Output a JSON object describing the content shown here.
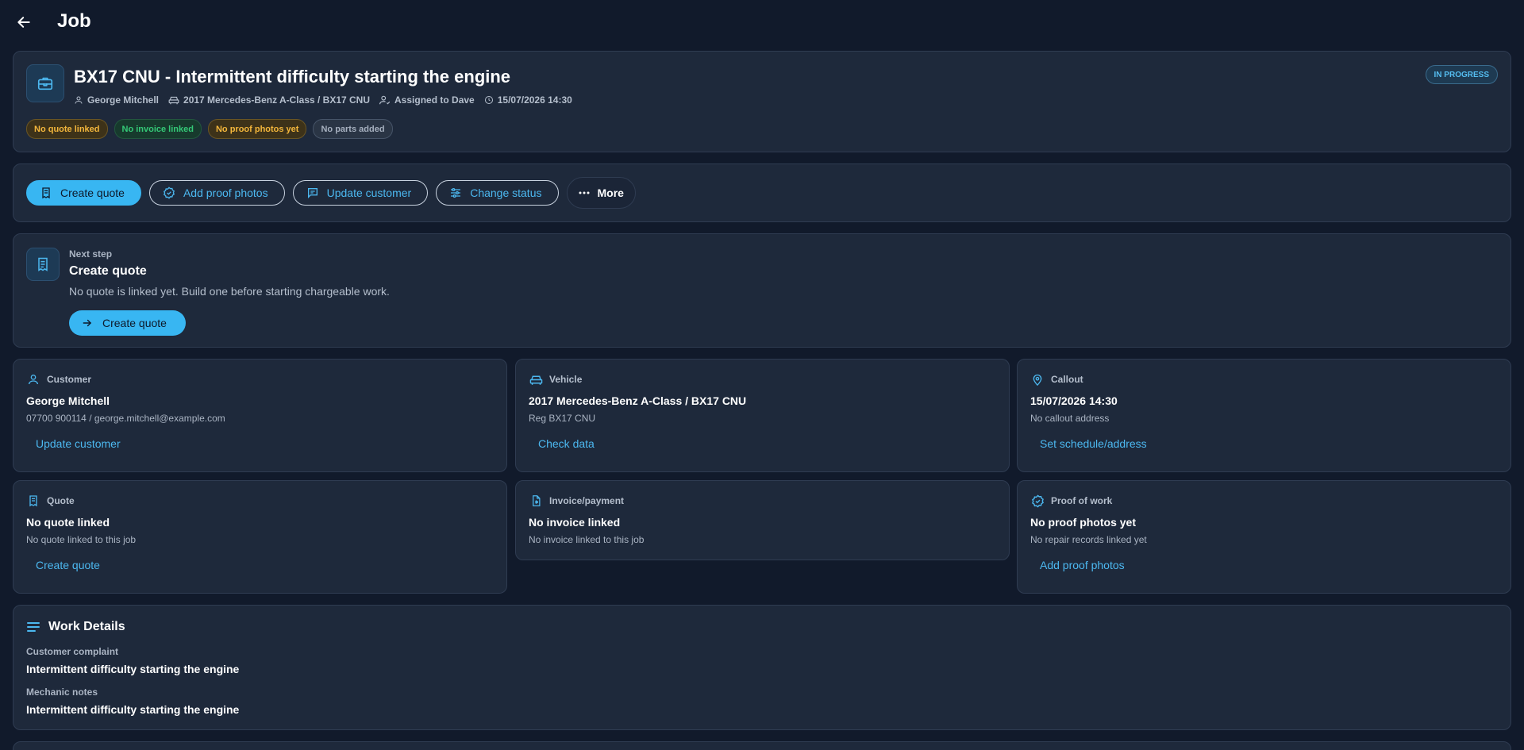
{
  "topbar": {
    "title": "Job"
  },
  "job": {
    "title": "BX17 CNU - Intermittent difficulty starting the engine",
    "customer": "George Mitchell",
    "vehicle": "2017 Mercedes-Benz A-Class / BX17 CNU",
    "assigned": "Assigned to Dave",
    "datetime": "15/07/2026 14:30",
    "status": "IN PROGRESS",
    "chips": [
      {
        "label": "No quote linked",
        "tone": "amber"
      },
      {
        "label": "No invoice linked",
        "tone": "green"
      },
      {
        "label": "No proof photos yet",
        "tone": "amber"
      },
      {
        "label": "No parts added",
        "tone": "gray"
      }
    ]
  },
  "actions": {
    "create_quote": "Create quote",
    "add_proof_photos": "Add proof photos",
    "update_customer": "Update customer",
    "change_status": "Change status",
    "more": "More"
  },
  "next_step": {
    "label": "Next step",
    "title": "Create quote",
    "description": "No quote is linked yet. Build one before starting chargeable work.",
    "button": "Create quote"
  },
  "cards": {
    "customer": {
      "heading": "Customer",
      "title": "George Mitchell",
      "sub": "07700 900114 / george.mitchell@example.com",
      "link": "Update customer"
    },
    "vehicle": {
      "heading": "Vehicle",
      "title": "2017 Mercedes-Benz A-Class / BX17 CNU",
      "sub": "Reg BX17 CNU",
      "link": "Check data"
    },
    "callout": {
      "heading": "Callout",
      "title": "15/07/2026 14:30",
      "sub": "No callout address",
      "link": "Set schedule/address"
    },
    "quote": {
      "heading": "Quote",
      "title": "No quote linked",
      "sub": "No quote linked to this job",
      "link": "Create quote"
    },
    "invoice": {
      "heading": "Invoice/payment",
      "title": "No invoice linked",
      "sub": "No invoice linked to this job"
    },
    "proof": {
      "heading": "Proof of work",
      "title": "No proof photos yet",
      "sub": "No repair records linked yet",
      "link": "Add proof photos"
    }
  },
  "work_details": {
    "heading": "Work Details",
    "complaint_label": "Customer complaint",
    "complaint": "Intermittent difficulty starting the engine",
    "notes_label": "Mechanic notes",
    "notes": "Intermittent difficulty starting the engine"
  },
  "colors": {
    "background": "#111a2b",
    "card": "#1e293b",
    "accent": "#38b6f2",
    "amber": "#f4b73c",
    "green": "#34c977"
  }
}
